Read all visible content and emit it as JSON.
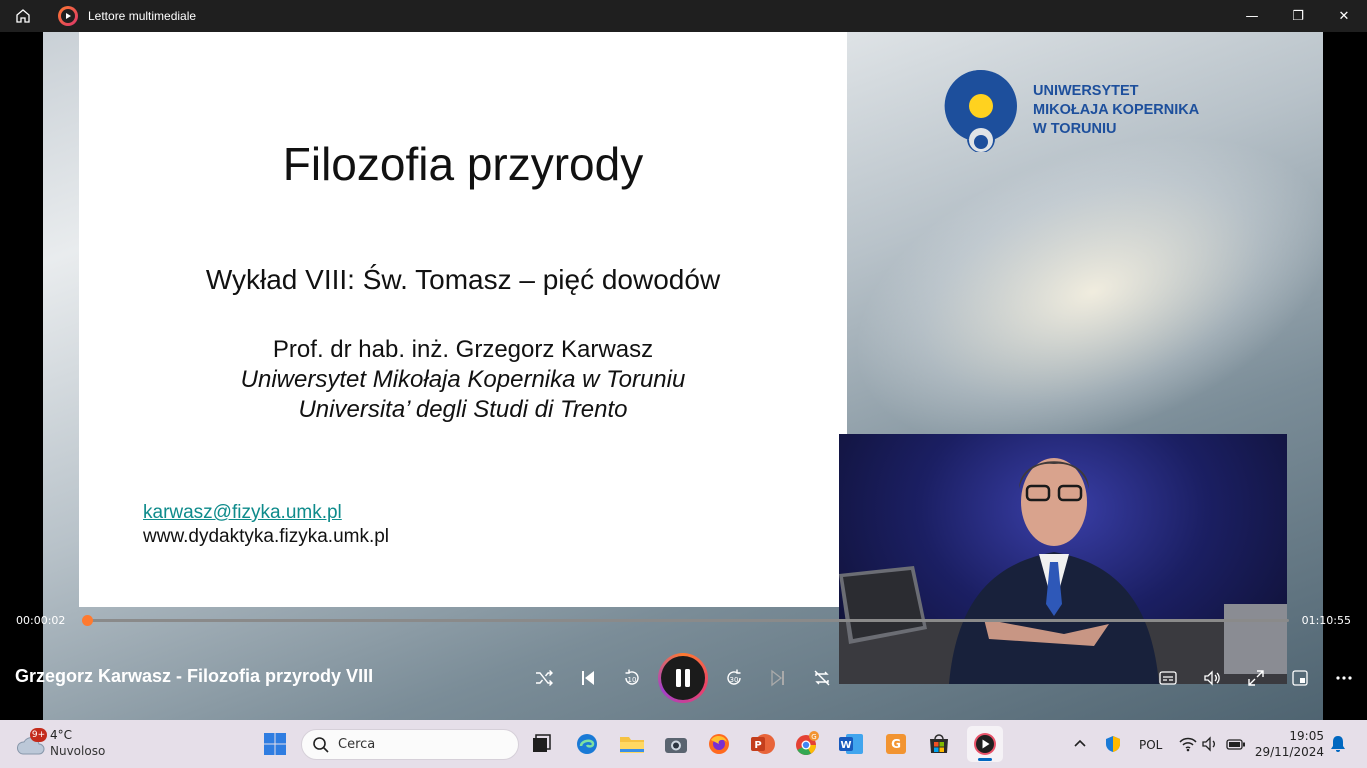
{
  "window": {
    "title": "Lettore multimediale",
    "controls": {
      "minimize": "—",
      "maximize": "❐",
      "close": "✕"
    }
  },
  "slide": {
    "title": "Filozofia przyrody",
    "subtitle": "Wykład VIII: Św. Tomasz – pięć dowodów",
    "author": "Prof. dr hab. inż. Grzegorz Karwasz",
    "affiliation1": "Uniwersytet Mikołaja Kopernika w Toruniu",
    "affiliation2": "Universita’ degli Studi di Trento",
    "email": "karwasz@fizyka.umk.pl",
    "website": "www.dydaktyka.fizyka.umk.pl"
  },
  "logo": {
    "line1": "UNIWERSYTET",
    "line2": "MIKOŁAJA KOPERNIKA",
    "line3": "W TORUNIU",
    "colors": {
      "blue": "#1d4f9c",
      "yellow": "#ffd21f"
    }
  },
  "player": {
    "current_time": "00:00:02",
    "total_time": "01:10:55",
    "progress_fraction": 0.0005,
    "media_title": "Grzegorz Karwasz - Filozofia przyrody VIII",
    "skip_back_label": "10",
    "skip_forward_label": "30",
    "accent_color": "#ff7a2f"
  },
  "taskbar": {
    "weather_badge": "9+",
    "weather_temp": "4°C",
    "weather_desc": "Nuvoloso",
    "search_placeholder": "Cerca",
    "language": "POL",
    "time": "19:05",
    "date": "29/11/2024",
    "pdf_badge": "G"
  },
  "icons": [
    "home-icon",
    "media-player-icon",
    "shuffle-icon",
    "previous-icon",
    "replay-10-icon",
    "pause-icon",
    "forward-30-icon",
    "next-icon",
    "repeat-off-icon",
    "subtitles-icon",
    "volume-icon",
    "fullscreen-icon",
    "miniplayer-icon",
    "more-icon"
  ]
}
